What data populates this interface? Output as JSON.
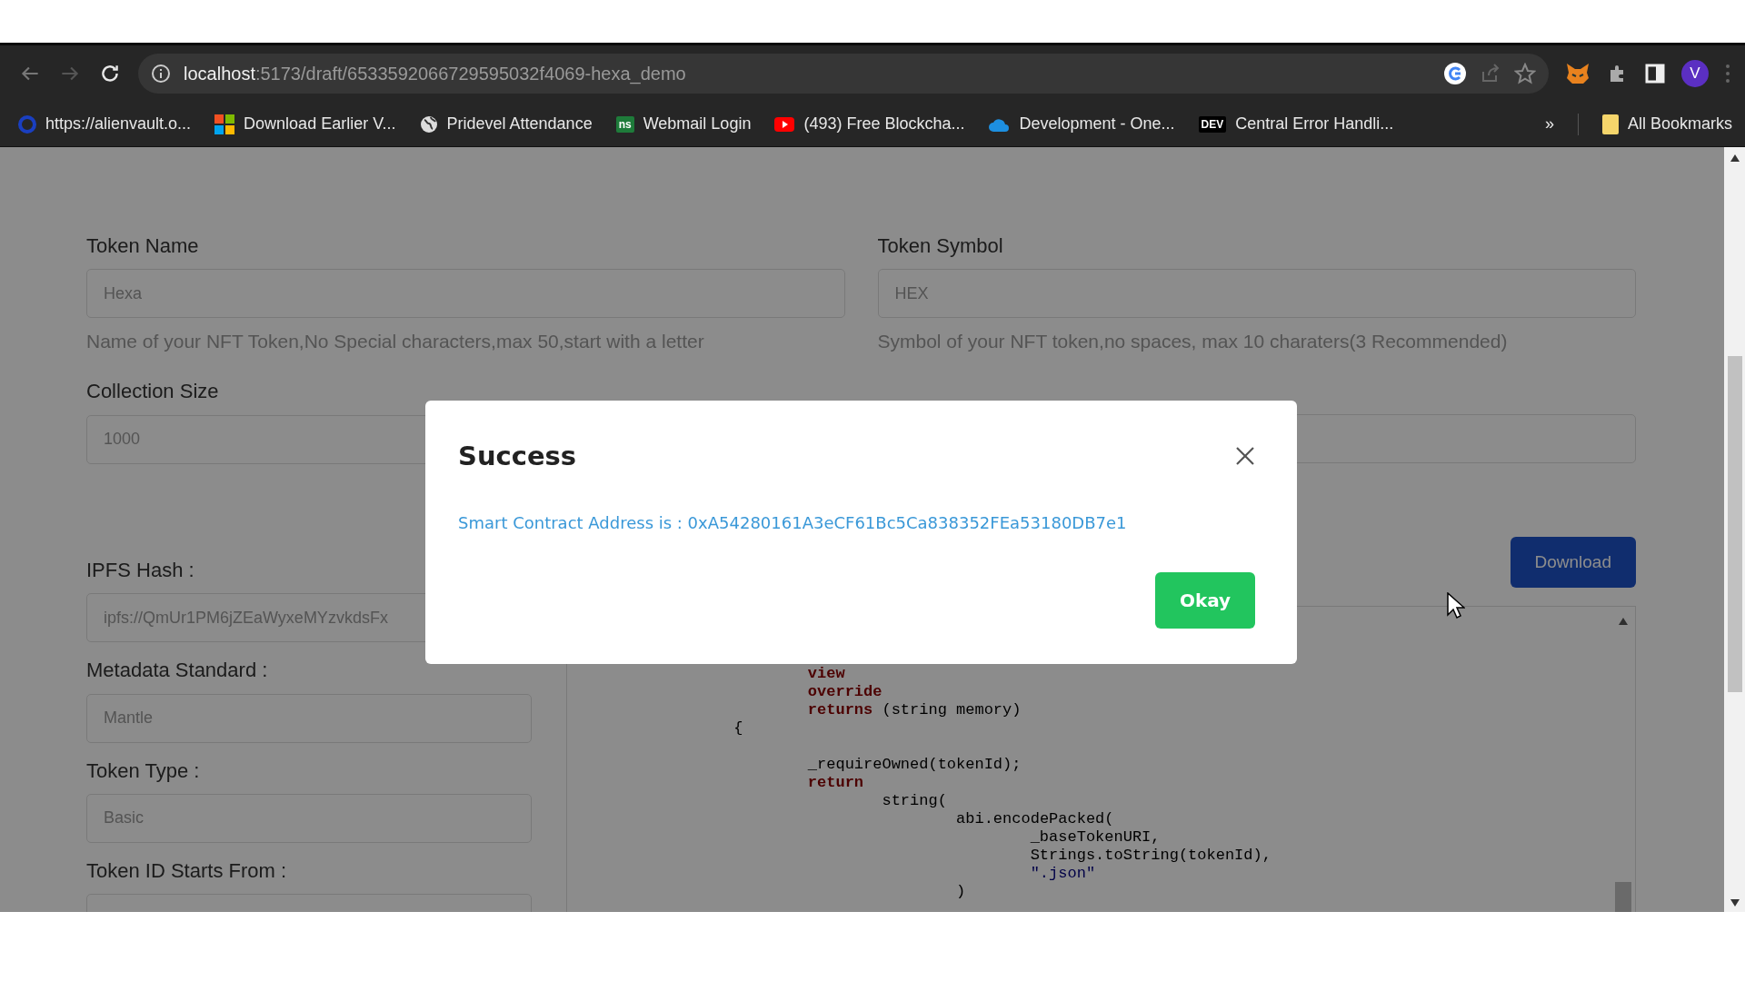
{
  "browser": {
    "url_host": "localhost",
    "url_path": ":5173/draft/6533592066729595032f4069-hexa_demo",
    "profile_initial": "V",
    "bookmarks": [
      {
        "kind": "circle",
        "label": "https://alienvault.o..."
      },
      {
        "kind": "windows",
        "label": "Download Earlier V..."
      },
      {
        "kind": "globe",
        "label": "Pridevel Attendance"
      },
      {
        "kind": "badge",
        "badge": "ns",
        "label": "Webmail Login"
      },
      {
        "kind": "youtube",
        "label": "(493) Free Blockcha..."
      },
      {
        "kind": "cloud",
        "label": "Development - One..."
      },
      {
        "kind": "dev",
        "badge": "DEV",
        "label": "Central Error Handli..."
      }
    ],
    "overflow": "»",
    "all_bookmarks": "All Bookmarks"
  },
  "form": {
    "top_fields": [
      {
        "label": "Token Name",
        "value": "Hexa",
        "hint": "Name of your NFT Token,No Special characters,max 50,start with a letter"
      },
      {
        "label": "Token Symbol",
        "value": "HEX",
        "hint": "Symbol of your NFT token,no spaces, max 10 charaters(3 Recommended)"
      }
    ],
    "collection_size": {
      "label": "Collection Size",
      "value": "1000"
    },
    "download_button": "Download",
    "left_fields": [
      {
        "label": "IPFS Hash :",
        "value": "ipfs://QmUr1PM6jZEaWyxeMYzvkdsFx"
      },
      {
        "label": "Metadata Standard :",
        "value": "Mantle"
      },
      {
        "label": "Token Type :",
        "value": "Basic"
      },
      {
        "label": "Token ID Starts From :"
      }
    ],
    "code_lines": [
      {
        "kind": "body",
        "parts": [
          {
            "kind": "keyword",
            "text": "view"
          }
        ]
      },
      {
        "kind": "body",
        "parts": [
          {
            "kind": "keyword",
            "text": "override"
          }
        ]
      },
      {
        "kind": "body",
        "parts": [
          {
            "kind": "keyword",
            "text": "returns"
          },
          {
            "kind": "plain",
            "text": " (string memory)"
          }
        ]
      },
      {
        "kind": "brace",
        "parts": [
          {
            "kind": "plain",
            "text": "{"
          }
        ]
      },
      {
        "kind": "blank"
      },
      {
        "kind": "body",
        "parts": [
          {
            "kind": "plain",
            "text": "_requireOwned(tokenId);"
          }
        ]
      },
      {
        "kind": "body",
        "parts": [
          {
            "kind": "keyword",
            "text": "return"
          }
        ]
      },
      {
        "kind": "call",
        "parts": [
          {
            "kind": "plain",
            "text": "string("
          }
        ]
      },
      {
        "kind": "inner",
        "parts": [
          {
            "kind": "plain",
            "text": "abi.encodePacked("
          }
        ]
      },
      {
        "kind": "arg",
        "parts": [
          {
            "kind": "plain",
            "text": "_baseTokenURI,"
          }
        ]
      },
      {
        "kind": "arg",
        "parts": [
          {
            "kind": "plain",
            "text": "Strings.toString(tokenId),"
          }
        ]
      },
      {
        "kind": "arg",
        "parts": [
          {
            "kind": "string",
            "text": "\".json\""
          }
        ]
      },
      {
        "kind": "inner",
        "parts": [
          {
            "kind": "plain",
            "text": ")"
          }
        ]
      }
    ]
  },
  "modal": {
    "title": "Success",
    "message": "Smart Contract Address is : 0xA54280161A3eCF61Bc5Ca838352FEa53180DB7e1",
    "button": "Okay"
  }
}
